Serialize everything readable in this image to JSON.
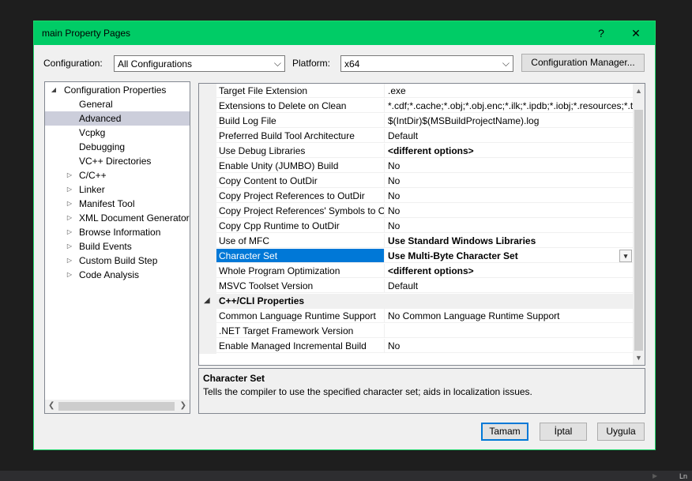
{
  "window": {
    "title": "main Property Pages",
    "help_glyph": "?",
    "close_glyph": "✕"
  },
  "config": {
    "configuration_label": "Configuration:",
    "configuration_value": "All Configurations",
    "platform_label": "Platform:",
    "platform_value": "x64",
    "manager_button": "Configuration Manager..."
  },
  "tree": {
    "items": [
      {
        "label": "Configuration Properties",
        "expander": "◢",
        "level": 0
      },
      {
        "label": "General",
        "expander": "",
        "level": 1
      },
      {
        "label": "Advanced",
        "expander": "",
        "level": 1,
        "selected": true
      },
      {
        "label": "Vcpkg",
        "expander": "",
        "level": 1
      },
      {
        "label": "Debugging",
        "expander": "",
        "level": 1
      },
      {
        "label": "VC++ Directories",
        "expander": "",
        "level": 1
      },
      {
        "label": "C/C++",
        "expander": "▷",
        "level": 1
      },
      {
        "label": "Linker",
        "expander": "▷",
        "level": 1
      },
      {
        "label": "Manifest Tool",
        "expander": "▷",
        "level": 1
      },
      {
        "label": "XML Document Generator",
        "expander": "▷",
        "level": 1
      },
      {
        "label": "Browse Information",
        "expander": "▷",
        "level": 1
      },
      {
        "label": "Build Events",
        "expander": "▷",
        "level": 1
      },
      {
        "label": "Custom Build Step",
        "expander": "▷",
        "level": 1
      },
      {
        "label": "Code Analysis",
        "expander": "▷",
        "level": 1
      }
    ]
  },
  "grid": {
    "rows": [
      {
        "name": "Target File Extension",
        "value": ".exe"
      },
      {
        "name": "Extensions to Delete on Clean",
        "value": "*.cdf;*.cache;*.obj;*.obj.enc;*.ilk;*.ipdb;*.iobj;*.resources;*.t"
      },
      {
        "name": "Build Log File",
        "value": "$(IntDir)$(MSBuildProjectName).log"
      },
      {
        "name": "Preferred Build Tool Architecture",
        "value": "Default"
      },
      {
        "name": "Use Debug Libraries",
        "value": "<different options>",
        "bold": true
      },
      {
        "name": "Enable Unity (JUMBO) Build",
        "value": "No"
      },
      {
        "name": "Copy Content to OutDir",
        "value": "No"
      },
      {
        "name": "Copy Project References to OutDir",
        "value": "No"
      },
      {
        "name": "Copy Project References' Symbols to Ou",
        "value": "No"
      },
      {
        "name": "Copy Cpp Runtime to OutDir",
        "value": "No"
      },
      {
        "name": "Use of MFC",
        "value": "Use Standard Windows Libraries",
        "bold": true
      },
      {
        "name": "Character Set",
        "value": "Use Multi-Byte Character Set",
        "bold": true,
        "selected": true
      },
      {
        "name": "Whole Program Optimization",
        "value": "<different options>",
        "bold": true
      },
      {
        "name": "MSVC Toolset Version",
        "value": "Default"
      },
      {
        "category": "C++/CLI Properties"
      },
      {
        "name": "Common Language Runtime Support",
        "value": "No Common Language Runtime Support"
      },
      {
        "name": ".NET Target Framework Version",
        "value": ""
      },
      {
        "name": "Enable Managed Incremental Build",
        "value": "No"
      }
    ]
  },
  "description": {
    "title": "Character Set",
    "text": "Tells the compiler to use the specified character set; aids in localization issues."
  },
  "buttons": {
    "ok": "Tamam",
    "cancel": "İptal",
    "apply": "Uygula"
  },
  "statusbar": {
    "text": "Ln"
  },
  "colors": {
    "title_bar": "#00cc66",
    "selection": "#0078d7",
    "tree_selection": "#cccedb"
  }
}
